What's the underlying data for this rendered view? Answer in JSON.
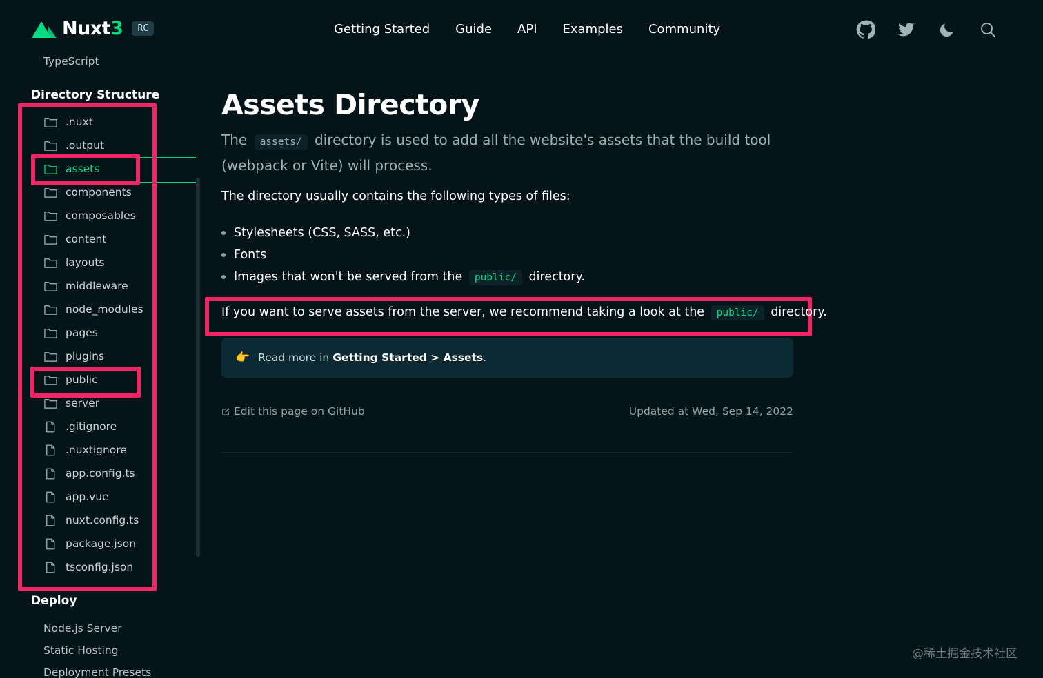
{
  "header": {
    "logo_text": "Nuxt",
    "logo_version": "3",
    "badge": "RC",
    "nav": [
      "Getting Started",
      "Guide",
      "API",
      "Examples",
      "Community"
    ],
    "icons": [
      "github-icon",
      "twitter-icon",
      "moon-icon",
      "search-icon"
    ]
  },
  "sidebar": {
    "typescript_link": "TypeScript",
    "section_directory": "Directory Structure",
    "tree": [
      {
        "label": ".nuxt",
        "type": "folder"
      },
      {
        "label": ".output",
        "type": "folder"
      },
      {
        "label": "assets",
        "type": "folder",
        "active": true
      },
      {
        "label": "components",
        "type": "folder"
      },
      {
        "label": "composables",
        "type": "folder"
      },
      {
        "label": "content",
        "type": "folder"
      },
      {
        "label": "layouts",
        "type": "folder"
      },
      {
        "label": "middleware",
        "type": "folder"
      },
      {
        "label": "node_modules",
        "type": "folder"
      },
      {
        "label": "pages",
        "type": "folder"
      },
      {
        "label": "plugins",
        "type": "folder"
      },
      {
        "label": "public",
        "type": "folder"
      },
      {
        "label": "server",
        "type": "folder"
      },
      {
        "label": ".gitignore",
        "type": "file"
      },
      {
        "label": ".nuxtignore",
        "type": "file"
      },
      {
        "label": "app.config.ts",
        "type": "file"
      },
      {
        "label": "app.vue",
        "type": "file"
      },
      {
        "label": "nuxt.config.ts",
        "type": "file"
      },
      {
        "label": "package.json",
        "type": "file"
      },
      {
        "label": "tsconfig.json",
        "type": "file"
      }
    ],
    "section_deploy": "Deploy",
    "deploy_links": [
      "Node.js Server",
      "Static Hosting",
      "Deployment Presets"
    ]
  },
  "main": {
    "title": "Assets Directory",
    "lead_pre": "The",
    "lead_code": "assets/",
    "lead_post": "directory is used to add all the website's assets that the build tool (webpack or Vite) will process.",
    "intro": "The directory usually contains the following types of files:",
    "bullets": {
      "b1": "Stylesheets (CSS, SASS, etc.)",
      "b2": "Fonts",
      "b3_pre": "Images that won't be served from the",
      "b3_code": "public/",
      "b3_post": "directory."
    },
    "note_pre": "If you want to serve assets from the server, we recommend taking a look at the",
    "note_code": "public/",
    "note_post": "directory.",
    "callout": {
      "icon": "pointing-hand-icon",
      "hand": "👉",
      "text": "Read more in",
      "link": "Getting Started > Assets",
      "end": "."
    },
    "edit_link": "Edit this page on GitHub",
    "updated": "Updated at Wed, Sep 14, 2022"
  },
  "watermark": "@稀土掘金技术社区",
  "colors": {
    "background": "#041418",
    "accent": "#00dc82",
    "highlight": "#ef2665"
  }
}
